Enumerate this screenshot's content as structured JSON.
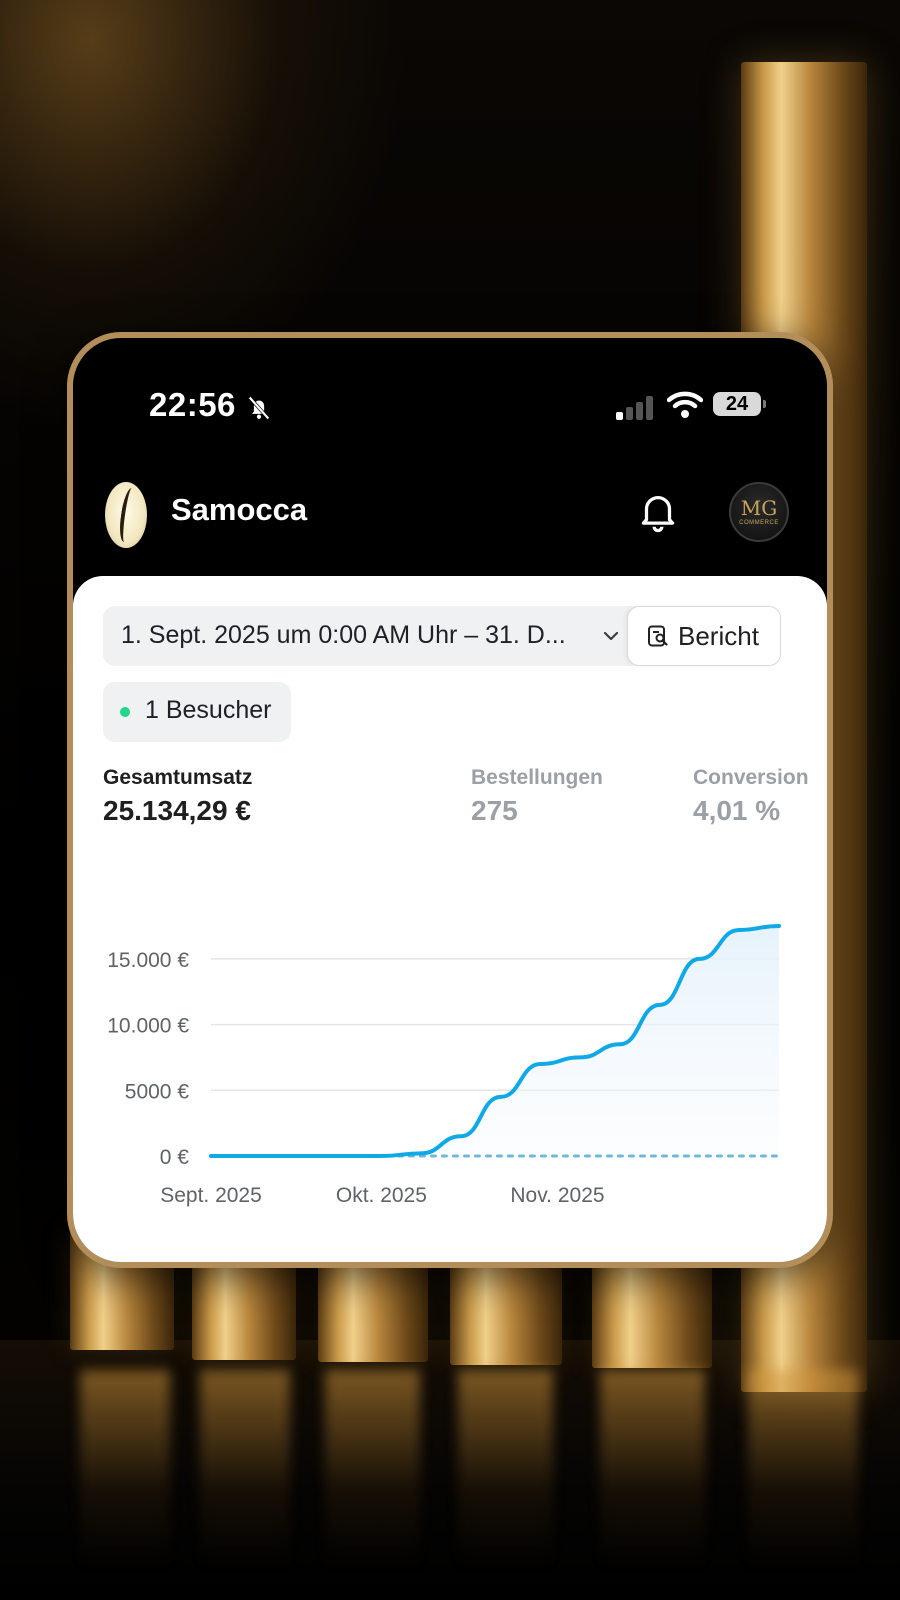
{
  "status_bar": {
    "time": "22:56",
    "battery": "24"
  },
  "app": {
    "name": "Samocca"
  },
  "avatar": {
    "initials": "MG",
    "subtitle": "COMMERCE"
  },
  "filters": {
    "date_range": "1. Sept. 2025 um 0:00 AM Uhr – 31. D...",
    "report_label": "Bericht",
    "visitors_label": "1 Besucher"
  },
  "metrics": [
    {
      "label": "Gesamtumsatz",
      "value": "25.134,29 €"
    },
    {
      "label": "Bestellungen",
      "value": "275"
    },
    {
      "label": "Conversion",
      "value": "4,01 %"
    }
  ],
  "colors": {
    "accent_line": "#0fa9e6",
    "live_dot": "#21d68a",
    "frame_gold": "#b38e5a"
  },
  "chart_data": {
    "type": "line",
    "x_labels": [
      "Sept. 2025",
      "Okt. 2025",
      "Nov. 2025"
    ],
    "y_ticks": [
      0,
      5000,
      10000,
      15000
    ],
    "y_tick_labels": [
      "0 €",
      "5000 €",
      "10.000 €",
      "15.000 €"
    ],
    "ylim": [
      0,
      17500
    ],
    "grid": true,
    "series": [
      {
        "x": [
          "2025-09-01",
          "2025-09-15",
          "2025-10-01",
          "2025-10-08",
          "2025-10-15",
          "2025-10-22",
          "2025-10-29",
          "2025-11-05",
          "2025-11-12",
          "2025-11-19",
          "2025-11-26",
          "2025-12-03",
          "2025-12-10"
        ],
        "values": [
          0,
          0,
          0,
          200,
          1500,
          4500,
          7000,
          7500,
          8500,
          11500,
          15000,
          17200,
          17500
        ]
      },
      {
        "style": "dotted",
        "x": [
          "2025-10-04",
          "2025-12-10"
        ],
        "values": [
          0,
          0
        ]
      }
    ]
  }
}
